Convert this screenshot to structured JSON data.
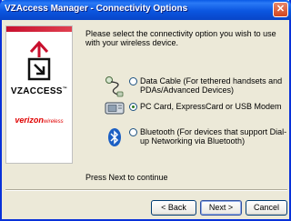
{
  "window": {
    "title": "VZAccess Manager - Connectivity Options",
    "close_glyph": "✕"
  },
  "sidepanel": {
    "product_name": "VZACCESS",
    "trademark": "™",
    "company_name": "verizon",
    "company_suffix": "wireless"
  },
  "content": {
    "instruction": "Please select the connectivity option you wish to use with your wireless device.",
    "options": [
      {
        "label": "Data Cable (For tethered handsets and PDAs/Advanced Devices)",
        "icon": "data-cable-icon",
        "checked": false
      },
      {
        "label": "PC Card, ExpressCard or USB Modem",
        "icon": "pc-card-icon",
        "checked": true
      },
      {
        "label": "Bluetooth (For devices that support Dial-up Networking via Bluetooth)",
        "icon": "bluetooth-icon",
        "checked": false
      }
    ],
    "footer": "Press Next to continue"
  },
  "buttons": {
    "back": "< Back",
    "next": "Next >",
    "cancel": "Cancel"
  },
  "colors": {
    "titlebar": "#0b56e0",
    "brand_red": "#c8102e",
    "bluetooth": "#1b5fc4"
  }
}
